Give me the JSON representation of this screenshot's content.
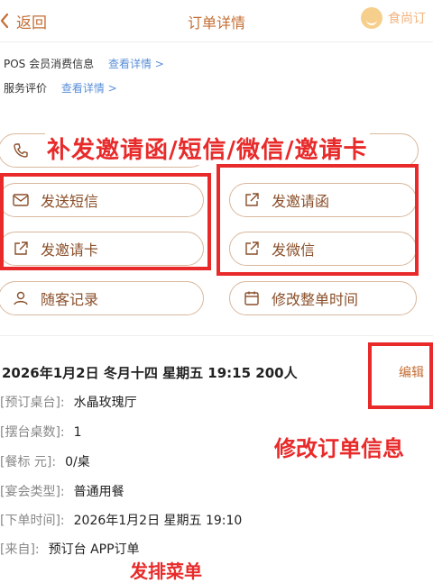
{
  "header": {
    "back_label": "返回",
    "title": "订单详情",
    "logo_text": "食尚订"
  },
  "info": {
    "pos_label": "POS 会员消费信息",
    "pos_link": "查看详情 >",
    "review_label": "服务评价",
    "review_link": "查看详情 >"
  },
  "buttons": {
    "send_sms": "发送短信",
    "send_invitation_letter": "发邀请函",
    "send_invitation_card": "发邀请卡",
    "send_wechat": "发微信",
    "guest_record": "随客记录",
    "modify_time": "修改整单时间"
  },
  "annotations": {
    "resend": "补发邀请函/短信/微信/邀请卡",
    "modify_order": "修改订单信息",
    "send_menu": "发排菜单"
  },
  "order": {
    "summary": "2026年1月2日  冬月十四  星期五  19:15    200人",
    "edit_label": "编辑",
    "fields": [
      {
        "key": "[预订桌台]:",
        "value": "水晶玫瑰厅"
      },
      {
        "key": "[摆台桌数]:",
        "value": "1"
      },
      {
        "key": "[餐标  元]:",
        "value": "0/桌"
      },
      {
        "key": "[宴会类型]:",
        "value": "普通用餐"
      },
      {
        "key": "[下单时间]:",
        "value": "2026年1月2日 星期五 19:10"
      },
      {
        "key": "[来自]:",
        "value": "预订台  APP订单"
      }
    ]
  },
  "colors": {
    "accent": "#c46e35",
    "annotation_red": "#e82a2a",
    "link_blue": "#5a8fd8",
    "pill_border": "#d9b79c"
  }
}
